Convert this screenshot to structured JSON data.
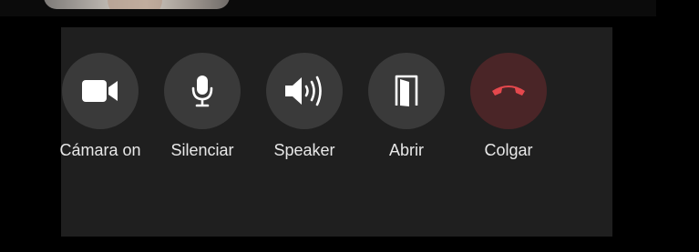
{
  "call_controls": {
    "camera": {
      "label": "Cámara on",
      "icon": "video-camera-icon"
    },
    "mute": {
      "label": "Silenciar",
      "icon": "microphone-icon"
    },
    "speaker": {
      "label": "Speaker",
      "icon": "speaker-volume-icon"
    },
    "open": {
      "label": "Abrir",
      "icon": "open-door-icon"
    },
    "hangup": {
      "label": "Colgar",
      "icon": "phone-hangup-icon"
    }
  },
  "colors": {
    "background": "#000000",
    "panel": "#1f1f1f",
    "button": "#3a3a3a",
    "hangup_button": "#4a2527",
    "hangup_icon": "#e5484d",
    "icon": "#ffffff",
    "label": "#e8e8e8"
  }
}
